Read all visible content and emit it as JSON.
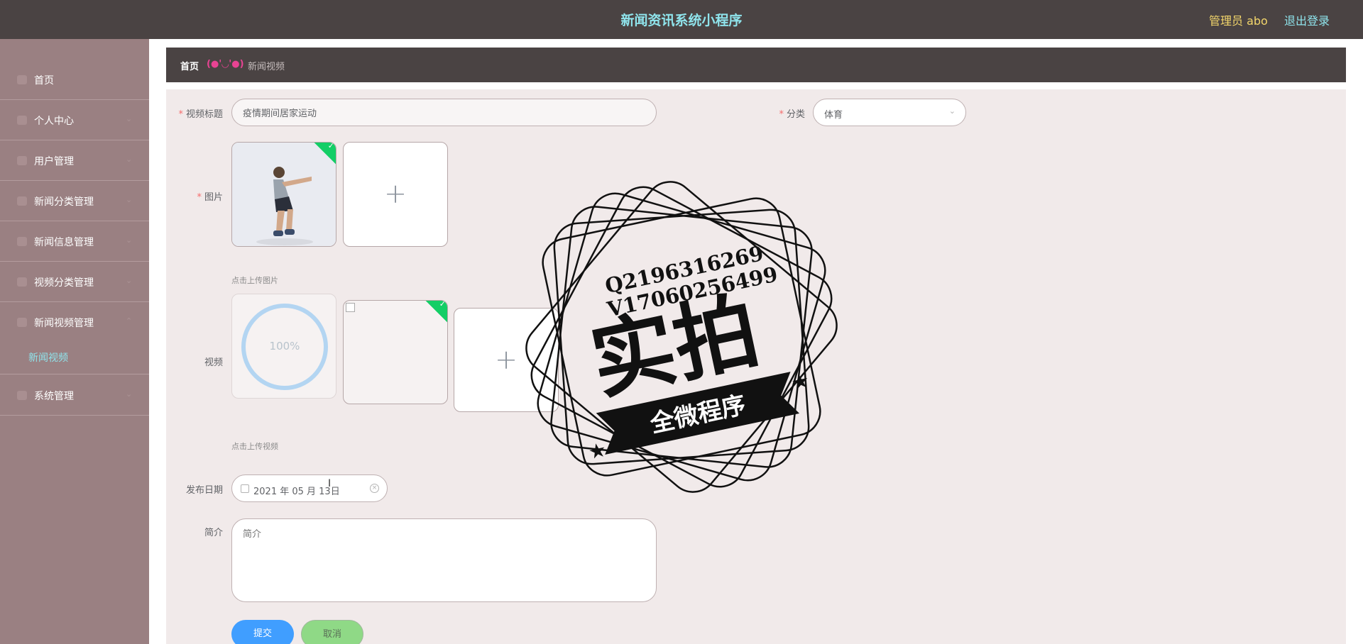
{
  "header": {
    "title": "新闻资讯系统小程序",
    "user": "管理员 abo",
    "logout": "退出登录"
  },
  "sidebar": {
    "items": [
      {
        "label": "首页",
        "icon": "home-icon"
      },
      {
        "label": "个人中心",
        "icon": "user-icon"
      },
      {
        "label": "用户管理",
        "icon": "users-icon"
      },
      {
        "label": "新闻分类管理",
        "icon": "category-icon"
      },
      {
        "label": "新闻信息管理",
        "icon": "news-icon"
      },
      {
        "label": "视频分类管理",
        "icon": "chart-icon"
      },
      {
        "label": "新闻视频管理",
        "icon": "video-icon"
      },
      {
        "label": "系统管理",
        "icon": "settings-icon"
      }
    ],
    "subitem": "新闻视频"
  },
  "breadcrumb": {
    "home": "首页",
    "separator": "(●'◡'●)",
    "current": "新闻视频"
  },
  "form": {
    "title_label": "视频标题",
    "title_value": "疫情期间居家运动",
    "category_label": "分类",
    "category_value": "体育",
    "image_label": "图片",
    "image_hint": "点击上传图片",
    "video_label": "视频",
    "video_progress": "100%",
    "video_hint": "点击上传视频",
    "date_label": "发布日期",
    "date_value": "2021 年 05 月 13日",
    "intro_label": "简介",
    "intro_placeholder": "简介",
    "submit": "提交",
    "cancel": "取消"
  },
  "watermark": {
    "line1": "Q2196316269",
    "line2": "V17060256499",
    "main": "实拍",
    "ribbon": "全微程序"
  },
  "colors": {
    "header_bg": "#4a4343",
    "sidebar_bg": "#9a8082",
    "accent_cyan": "#8fe4ec",
    "submit_blue": "#409eff",
    "cancel_green": "#8fd986",
    "success_green": "#13ce66"
  }
}
